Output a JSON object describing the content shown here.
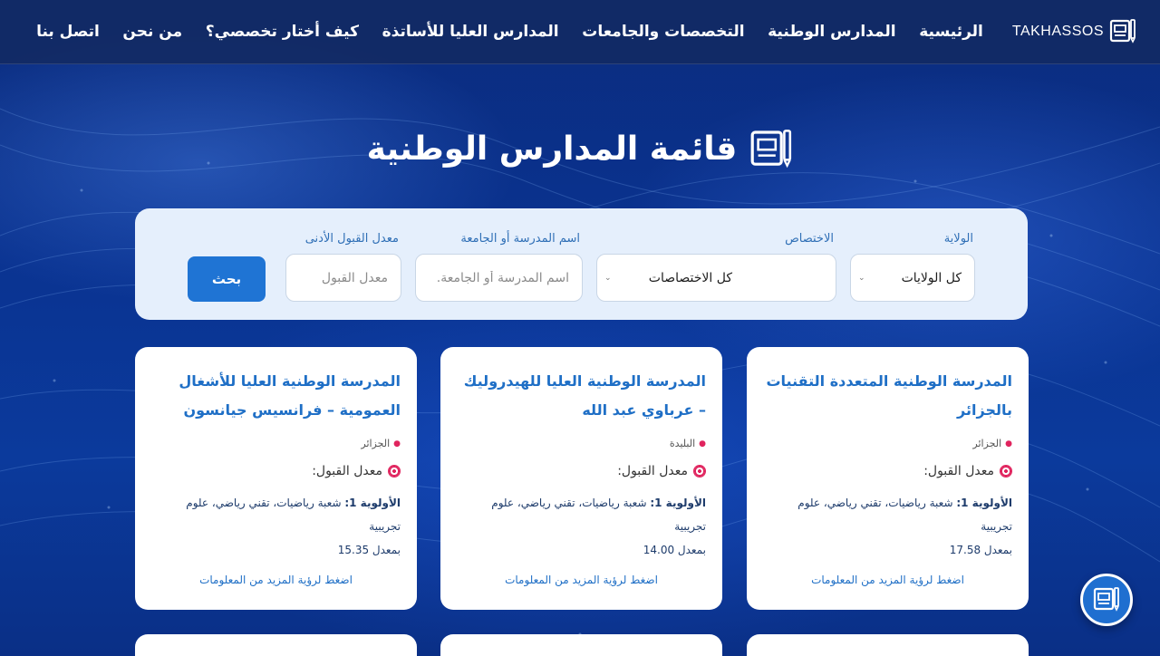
{
  "brand": {
    "name": "TAKHASSOS"
  },
  "nav": {
    "items": [
      {
        "label": "الرئيسية"
      },
      {
        "label": "المدارس الوطنية"
      },
      {
        "label": "التخصصات والجامعات"
      },
      {
        "label": "المدارس العليا للأساتذة"
      },
      {
        "label": "كيف أختار تخصصي؟"
      },
      {
        "label": "من نحن"
      },
      {
        "label": "اتصل بنا"
      }
    ]
  },
  "page": {
    "title": "قائمة المدارس الوطنية"
  },
  "filters": {
    "wilaya_label": "الولاية",
    "wilaya_value": "كل الولايات",
    "specialty_label": "الاختصاص",
    "specialty_value": "كل الاختصاصات",
    "name_label": "اسم المدرسة أو الجامعة",
    "name_placeholder": "اسم المدرسة أو الجامعة.",
    "rate_label": "معدل القبول الأدنى",
    "rate_placeholder": "معدل القبول",
    "search_label": "بحث"
  },
  "cards": [
    {
      "title": "المدرسة الوطنية المتعددة التقنيات بالجزائر",
      "location": "الجزائر",
      "rate_label": "معدل القبول:",
      "priority_label": "الأولوية 1:",
      "priority_text": "شعبة رياضيات، تقني رياضي، علوم تجريبية",
      "min_rate": "بمعدل 17.58",
      "more": "اضغط لرؤية المزيد من المعلومات"
    },
    {
      "title": "المدرسة الوطنية العليا للهيدروليك – عرباوي عبد الله",
      "location": "البليدة",
      "rate_label": "معدل القبول:",
      "priority_label": "الأولوية 1:",
      "priority_text": "شعبة رياضيات، تقني رياضي، علوم تجريبية",
      "min_rate": "بمعدل 14.00",
      "more": "اضغط لرؤية المزيد من المعلومات"
    },
    {
      "title": "المدرسة الوطنية العليا للأشغال العمومية – فرانسيس جيانسون",
      "location": "الجزائر",
      "rate_label": "معدل القبول:",
      "priority_label": "الأولوية 1:",
      "priority_text": "شعبة رياضيات، تقني رياضي، علوم تجريبية",
      "min_rate": "بمعدل 15.35",
      "more": "اضغط لرؤية المزيد من المعلومات"
    }
  ],
  "icons": {
    "logo": "book-pencil-icon",
    "location": "pin-icon",
    "rate": "target-icon",
    "fab": "book-pencil-icon"
  },
  "colors": {
    "accent": "#1f74d4",
    "card_title": "#1f6fc6",
    "panel": "#e5effc"
  }
}
